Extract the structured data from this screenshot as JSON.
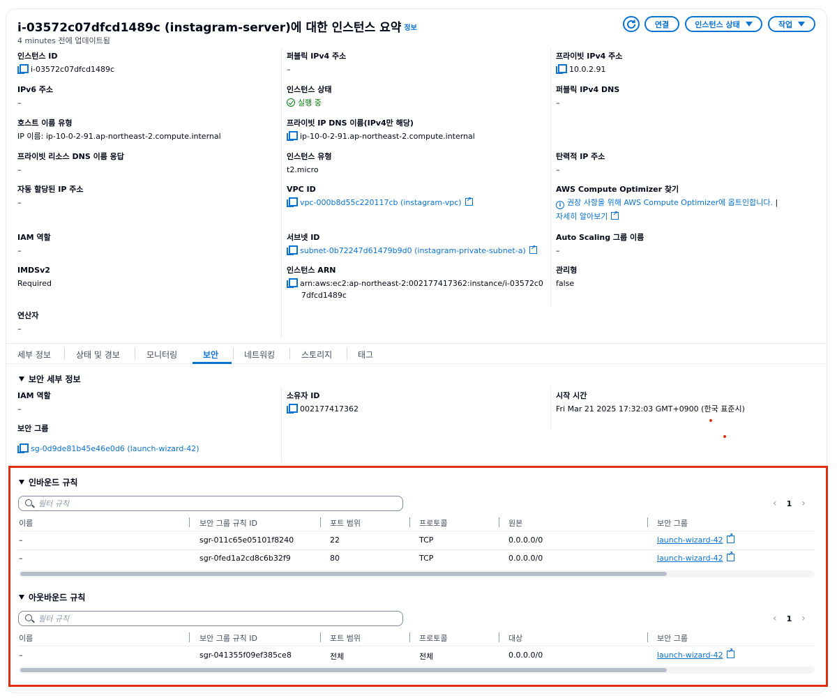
{
  "header": {
    "title": "i-03572c07dfcd1489c (instagram-server)에 대한 인스턴스 요약",
    "info": "정보",
    "updated": "4 minutes 전에 업데이트됨",
    "buttons": {
      "connect": "연결",
      "instance_state": "인스턴스 상태",
      "actions": "작업"
    }
  },
  "fields": {
    "instance_id": {
      "label": "인스턴스 ID",
      "value": "i-03572c07dfcd1489c"
    },
    "public_ipv4": {
      "label": "퍼블릭 IPv4 주소",
      "value": "–"
    },
    "private_ipv4": {
      "label": "프라이빗 IPv4 주소",
      "value": "10.0.2.91"
    },
    "ipv6": {
      "label": "IPv6 주소",
      "value": "–"
    },
    "instance_state": {
      "label": "인스턴스 상태",
      "value": "실행 중"
    },
    "public_dns": {
      "label": "퍼블릭 IPv4 DNS",
      "value": "–"
    },
    "hostname_type": {
      "label": "호스트 이름 유형",
      "value": "IP 이름: ip-10-0-2-91.ap-northeast-2.compute.internal"
    },
    "private_dns": {
      "label": "프라이빗 IP DNS 이름(IPv4만 해당)",
      "value": "ip-10-0-2-91.ap-northeast-2.compute.internal"
    },
    "private_resource_dns": {
      "label": "프라이빗 리소스 DNS 이름 응답",
      "value": "–"
    },
    "instance_type": {
      "label": "인스턴스 유형",
      "value": "t2.micro"
    },
    "elastic_ip": {
      "label": "탄력적 IP 주소",
      "value": "–"
    },
    "auto_ip": {
      "label": "자동 할당된 IP 주소",
      "value": "–"
    },
    "vpc_id": {
      "label": "VPC ID",
      "value": "vpc-000b8d55c220117cb (instagram-vpc)"
    },
    "optimizer": {
      "label": "AWS Compute Optimizer 찾기",
      "value": "권장 사항을 위해 AWS Compute Optimizer에 옵트인합니다.",
      "more": "자세히 알아보기"
    },
    "iam_role": {
      "label": "IAM 역할",
      "value": "–"
    },
    "subnet_id": {
      "label": "서브넷 ID",
      "value": "subnet-0b72247d61479b9d0 (instagram-private-subnet-a)"
    },
    "asg_name": {
      "label": "Auto Scaling 그룹 이름",
      "value": "–"
    },
    "imdsv2": {
      "label": "IMDSv2",
      "value": "Required"
    },
    "arn": {
      "label": "인스턴스 ARN",
      "value_line1": "arn:aws:ec2:ap-northeast-2:002177417362:instance/i-03572c0",
      "value_line2": "7dfcd1489c"
    },
    "managed": {
      "label": "관리형",
      "value": "false"
    },
    "operator": {
      "label": "연산자",
      "value": "–"
    }
  },
  "tabs": [
    "세부 정보",
    "상태 및 경보",
    "모니터링",
    "보안",
    "네트워킹",
    "스토리지",
    "태그"
  ],
  "security": {
    "title": "보안 세부 정보",
    "iam_role": {
      "label": "IAM 역할",
      "value": "–"
    },
    "owner_id": {
      "label": "소유자 ID",
      "value": "002177417362"
    },
    "launch_time": {
      "label": "시작 시간",
      "value": "Fri Mar 21 2025 17:32:03 GMT+0900 (한국 표준시)"
    },
    "security_groups": {
      "label": "보안 그룹",
      "value": "sg-0d9de81b45e46e0d6 (launch-wizard-42)"
    }
  },
  "inbound": {
    "title": "인바운드 규칙",
    "placeholder": "필터 규칙",
    "page": "1",
    "columns": [
      "이름",
      "보안 그룹 규칙 ID",
      "포트 범위",
      "프로토콜",
      "원본",
      "보안 그룹"
    ],
    "rows": [
      [
        "–",
        "sgr-011c65e05101f8240",
        "22",
        "TCP",
        "0.0.0.0/0",
        "launch-wizard-42"
      ],
      [
        "–",
        "sgr-0fed1a2cd8c6b32f9",
        "80",
        "TCP",
        "0.0.0.0/0",
        "launch-wizard-42"
      ]
    ]
  },
  "outbound": {
    "title": "아웃바운드 규칙",
    "placeholder": "필터 규칙",
    "page": "1",
    "columns": [
      "이름",
      "보안 그룹 규칙 ID",
      "포트 범위",
      "프로토콜",
      "대상",
      "보안 그룹"
    ],
    "rows": [
      [
        "–",
        "sgr-041355f09ef385ce8",
        "전체",
        "전체",
        "0.0.0.0/0",
        "launch-wizard-42"
      ]
    ]
  },
  "colors": {
    "link": "#0972d3",
    "success": "#037f0c",
    "highlight": "#e02f10"
  }
}
